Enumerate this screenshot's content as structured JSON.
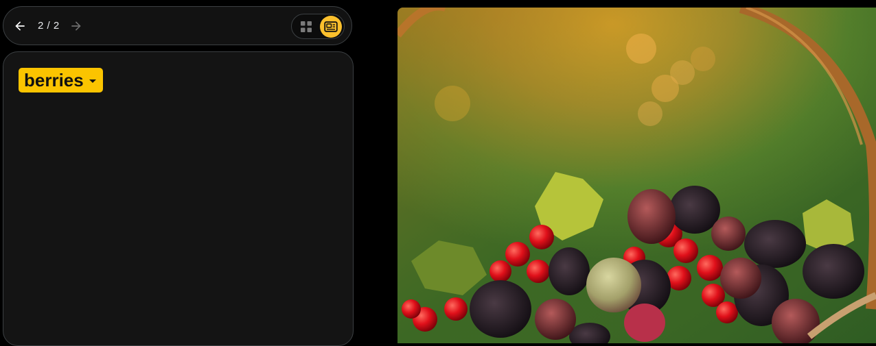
{
  "nav": {
    "counter": "2 / 2",
    "back_icon": "arrow-left-icon",
    "forward_icon": "arrow-right-icon",
    "grid_icon": "grid-view-icon",
    "detail_icon": "detail-view-icon"
  },
  "panel": {
    "tag_label": "berries"
  },
  "colors": {
    "accent": "#fbc400",
    "background": "#000000",
    "panel": "#141414"
  }
}
